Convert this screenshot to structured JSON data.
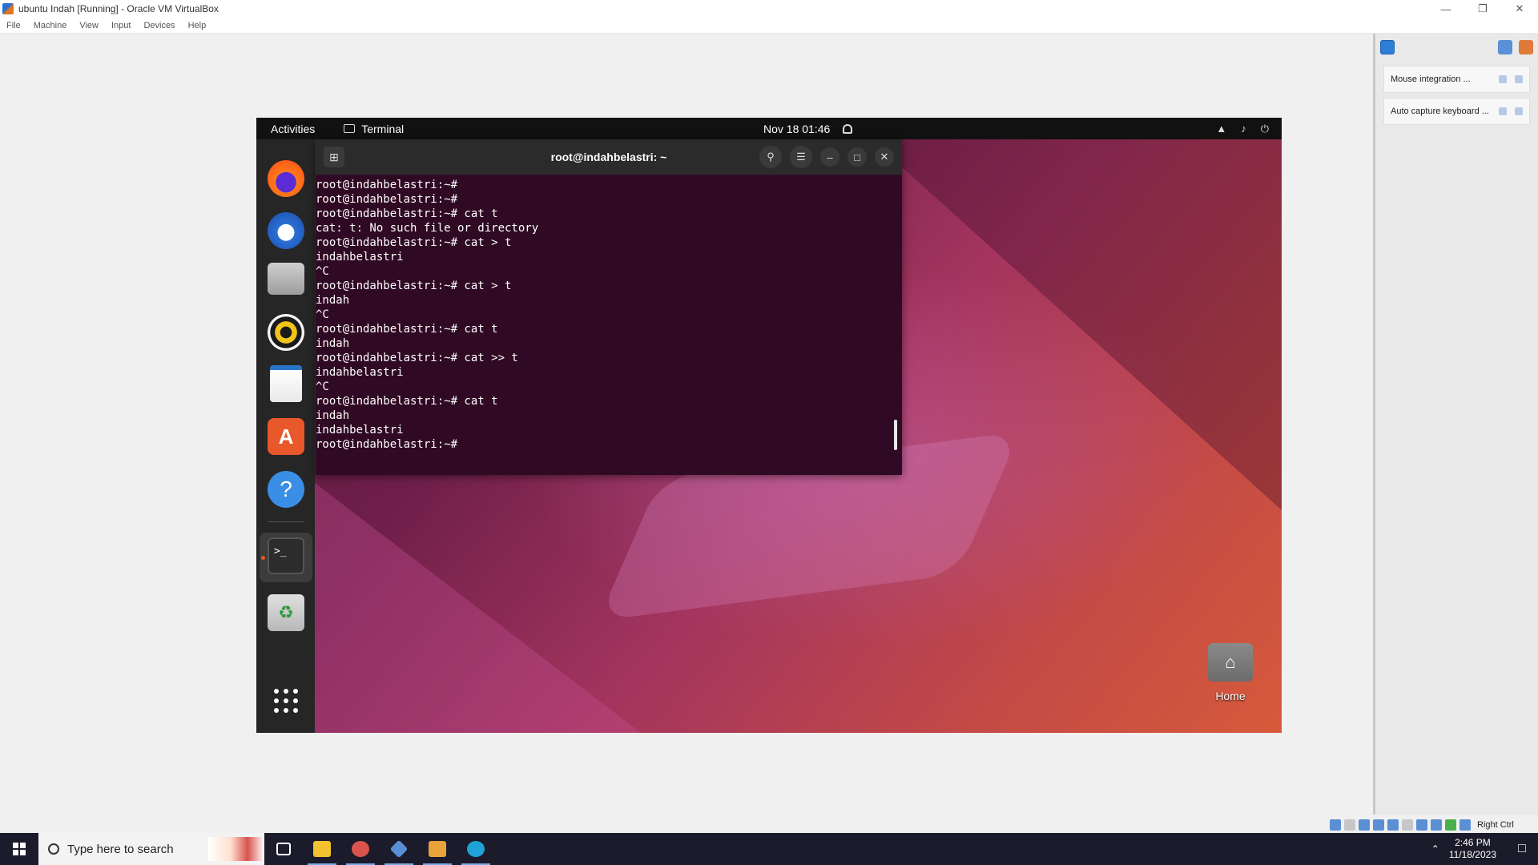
{
  "host": {
    "window_title": "ubuntu Indah [Running] - Oracle VM VirtualBox",
    "menu": [
      "File",
      "Machine",
      "View",
      "Input",
      "Devices",
      "Help"
    ],
    "notifications": [
      {
        "text": "Mouse integration ..."
      },
      {
        "text": "Auto capture keyboard ..."
      }
    ],
    "host_key": "Right Ctrl"
  },
  "guest": {
    "topbar": {
      "activities": "Activities",
      "app_name": "Terminal",
      "datetime": "Nov 18  01:46"
    },
    "desktop": {
      "home_label": "Home"
    },
    "terminal": {
      "title": "root@indahbelastri: ~",
      "lines": [
        "root@indahbelastri:~#",
        "root@indahbelastri:~#",
        "root@indahbelastri:~# cat t",
        "cat: t: No such file or directory",
        "root@indahbelastri:~# cat > t",
        "indahbelastri",
        "^C",
        "root@indahbelastri:~# cat > t",
        "indah",
        "^C",
        "root@indahbelastri:~# cat t",
        "indah",
        "root@indahbelastri:~# cat >> t",
        "indahbelastri",
        "^C",
        "root@indahbelastri:~# cat t",
        "indah",
        "indahbelastri",
        "root@indahbelastri:~#"
      ]
    }
  },
  "taskbar": {
    "search_placeholder": "Type here to search",
    "time": "2:46 PM",
    "date": "11/18/2023"
  },
  "colors": {
    "terminal_bg": "#300a24",
    "ubuntu_orange": "#e95420",
    "taskbar_bg": "#1b1b2b"
  }
}
